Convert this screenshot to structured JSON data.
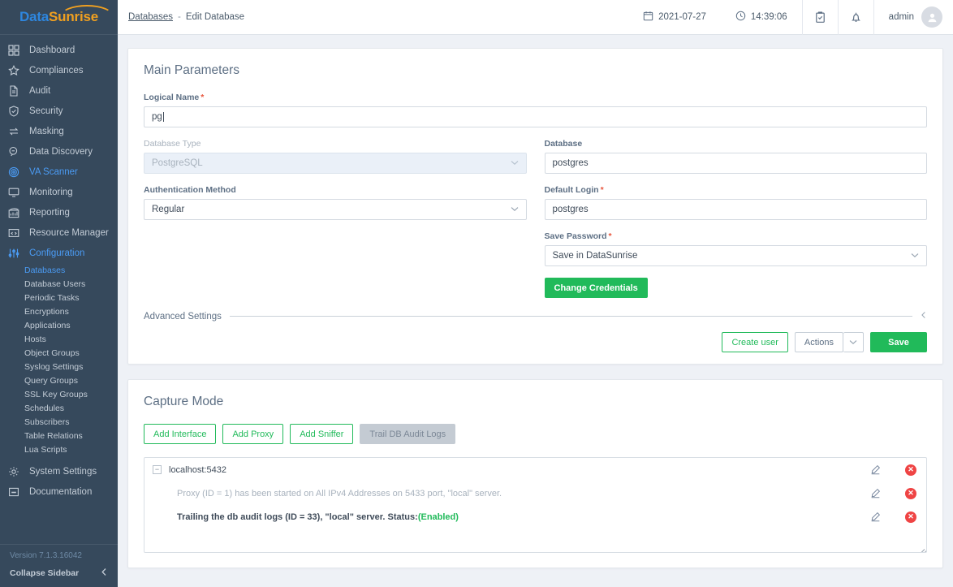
{
  "brand": {
    "part1": "Data",
    "part2": "Sunrise"
  },
  "sidebar": {
    "items": [
      {
        "label": "Dashboard",
        "icon": "grid-icon",
        "active": false
      },
      {
        "label": "Compliances",
        "icon": "star-icon",
        "active": false
      },
      {
        "label": "Audit",
        "icon": "document-icon",
        "active": false
      },
      {
        "label": "Security",
        "icon": "shield-check-icon",
        "active": false
      },
      {
        "label": "Masking",
        "icon": "swap-arrows-icon",
        "active": false
      },
      {
        "label": "Data Discovery",
        "icon": "magnifier-chat-icon",
        "active": false
      },
      {
        "label": "VA Scanner",
        "icon": "target-rings-icon",
        "active": true
      },
      {
        "label": "Monitoring",
        "icon": "monitor-icon",
        "active": false
      },
      {
        "label": "Reporting",
        "icon": "bar-chart-icon",
        "active": false
      },
      {
        "label": "Resource Manager",
        "icon": "server-box-icon",
        "active": false
      },
      {
        "label": "Configuration",
        "icon": "sliders-icon",
        "active": true
      }
    ],
    "sub_items": [
      {
        "label": "Databases",
        "active": true
      },
      {
        "label": "Database Users",
        "active": false
      },
      {
        "label": "Periodic Tasks",
        "active": false
      },
      {
        "label": "Encryptions",
        "active": false
      },
      {
        "label": "Applications",
        "active": false
      },
      {
        "label": "Hosts",
        "active": false
      },
      {
        "label": "Object Groups",
        "active": false
      },
      {
        "label": "Syslog Settings",
        "active": false
      },
      {
        "label": "Query Groups",
        "active": false
      },
      {
        "label": "SSL Key Groups",
        "active": false
      },
      {
        "label": "Schedules",
        "active": false
      },
      {
        "label": "Subscribers",
        "active": false
      },
      {
        "label": "Table Relations",
        "active": false
      },
      {
        "label": "Lua Scripts",
        "active": false
      }
    ],
    "tail_items": [
      {
        "label": "System Settings",
        "icon": "gear-icon",
        "active": false
      },
      {
        "label": "Documentation",
        "icon": "book-icon",
        "active": false
      }
    ],
    "version": "Version 7.1.3.16042",
    "collapse_label": "Collapse Sidebar",
    "collapse_icon": "chevron-left-icon"
  },
  "topbar": {
    "breadcrumb_link": "Databases",
    "breadcrumb_sep": "-",
    "breadcrumb_current": "Edit Database",
    "date": "2021-07-27",
    "date_icon": "calendar-icon",
    "time": "14:39:06",
    "time_icon": "clock-icon",
    "tasks_icon": "clipboard-check-icon",
    "bell_icon": "bell-icon",
    "user": "admin",
    "avatar_icon": "user-avatar-icon"
  },
  "main_parameters": {
    "title": "Main Parameters",
    "logical_name": {
      "label": "Logical Name",
      "required": true,
      "value": "pg"
    },
    "database_type": {
      "label": "Database Type",
      "required": false,
      "value": "PostgreSQL",
      "disabled": true
    },
    "authentication_method": {
      "label": "Authentication Method",
      "required": false,
      "value": "Regular"
    },
    "database": {
      "label": "Database",
      "required": false,
      "value": "postgres"
    },
    "default_login": {
      "label": "Default Login",
      "required": true,
      "value": "postgres"
    },
    "save_password": {
      "label": "Save Password",
      "required": true,
      "value": "Save in DataSunrise"
    },
    "change_credentials_label": "Change Credentials",
    "advanced_settings_label": "Advanced Settings",
    "advanced_collapse_icon": "chevron-left-icon",
    "buttons": {
      "create_user": "Create user",
      "actions": "Actions",
      "actions_caret_icon": "chevron-down-icon",
      "save": "Save"
    }
  },
  "capture_mode": {
    "title": "Capture Mode",
    "buttons": [
      {
        "label": "Add Interface",
        "style": "ghost-green"
      },
      {
        "label": "Add Proxy",
        "style": "ghost-green"
      },
      {
        "label": "Add Sniffer",
        "style": "ghost-green"
      },
      {
        "label": "Trail DB Audit Logs",
        "style": "gray-solid"
      }
    ],
    "tree": {
      "toggle_glyph": "−",
      "root_label": "localhost:5432",
      "rows": [
        {
          "text": "Proxy (ID = 1) has been started on All IPv4 Addresses on 5433 port, \"local\" server.",
          "style": "muted",
          "status": "",
          "indent": 1
        },
        {
          "text": "Trailing the db audit logs (ID = 33), \"local\" server. Status: ",
          "style": "bold",
          "status": "(Enabled)",
          "indent": 1
        }
      ]
    },
    "edit_icon": "pencil-icon",
    "delete_icon": "delete-circle-icon",
    "delete_glyph": "✕"
  },
  "colors": {
    "sidebar_bg": "#36495c",
    "accent_blue": "#4b9cf5",
    "accent_green": "#21ba5a",
    "brand_orange": "#f0a020",
    "danger_red": "#ef4444",
    "page_bg": "#eef1f6"
  }
}
